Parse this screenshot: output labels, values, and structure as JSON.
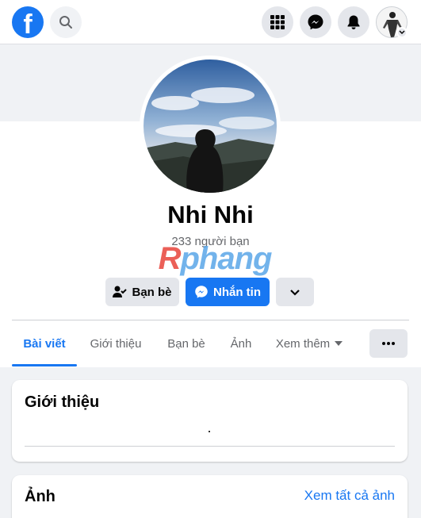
{
  "topbar": {
    "logo": "f",
    "icons": [
      "facebook-logo",
      "search-icon",
      "menu-grid-icon",
      "messenger-icon",
      "bell-icon",
      "account-avatar",
      "chevron-down-icon"
    ]
  },
  "profile": {
    "name": "Nhi Nhi",
    "friends_count": "233 người bạn"
  },
  "watermark": {
    "first": "R",
    "rest": "phang"
  },
  "actions": {
    "friends_label": "Bạn bè",
    "message_label": "Nhắn tin"
  },
  "tabs": [
    {
      "label": "Bài viết"
    },
    {
      "label": "Giới thiệu"
    },
    {
      "label": "Bạn bè"
    },
    {
      "label": "Ảnh"
    },
    {
      "label": "Xem thêm"
    }
  ],
  "intro": {
    "title": "Giới thiệu"
  },
  "photos": {
    "title": "Ảnh",
    "see_all": "Xem tất cả ảnh"
  },
  "colors": {
    "accent": "#1877f2",
    "button_gray": "#e4e6eb",
    "page_bg": "#f0f2f5"
  }
}
